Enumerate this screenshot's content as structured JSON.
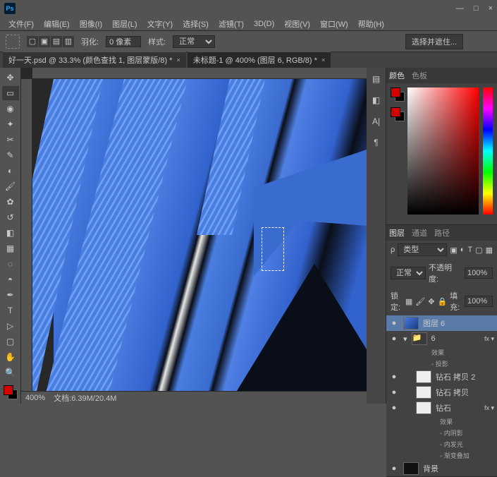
{
  "app": {
    "logo": "Ps"
  },
  "menu": [
    "文件(F)",
    "编辑(E)",
    "图像(I)",
    "图层(L)",
    "文字(Y)",
    "选择(S)",
    "滤镜(T)",
    "3D(D)",
    "视图(V)",
    "窗口(W)",
    "帮助(H)"
  ],
  "options": {
    "feather_label": "羽化:",
    "feather_value": "0 像素",
    "style_label": "样式:",
    "style_value": "正常",
    "adjust_btn": "选择并遮住..."
  },
  "tabs": [
    {
      "label": "好一天.psd @ 33.3% (颜色查找 1, 图层蒙版/8) *",
      "active": false
    },
    {
      "label": "未标题-1 @ 400% (图层 6, RGB/8) *",
      "active": true
    }
  ],
  "status": {
    "zoom": "400%",
    "doc": "文档:6.39M/20.4M"
  },
  "panels": {
    "color_tabs": [
      "颜色",
      "色板"
    ],
    "layers_tabs": [
      "图层",
      "通道",
      "路径"
    ],
    "kind_label": "类型",
    "blend_label": "正常",
    "opacity_label": "不透明度:",
    "opacity_value": "100%",
    "lock_label": "锁定:",
    "fill_label": "填充:",
    "fill_value": "100%"
  },
  "layers": [
    {
      "vis": "●",
      "name": "图层 6",
      "sel": true,
      "thumb": "blue"
    },
    {
      "vis": "●",
      "name": "6",
      "grp": true,
      "open": true
    },
    {
      "fx": "效果"
    },
    {
      "fx": "◦ 投影"
    },
    {
      "vis": "●",
      "name": "钻石 拷贝 2",
      "thumb": "wht",
      "ind": 1
    },
    {
      "vis": "●",
      "name": "钻石 拷贝",
      "thumb": "wht",
      "ind": 1
    },
    {
      "vis": "●",
      "name": "钻石",
      "thumb": "wht",
      "ind": 1,
      "hasfx": true
    },
    {
      "fx": "效果",
      "ind": 1
    },
    {
      "fx": "◦ 内阴影",
      "ind": 1
    },
    {
      "fx": "◦ 内发光",
      "ind": 1
    },
    {
      "fx": "◦ 渐变叠加",
      "ind": 1
    },
    {
      "vis": "●",
      "name": "背景",
      "thumb": "dark",
      "ind": 0
    }
  ]
}
